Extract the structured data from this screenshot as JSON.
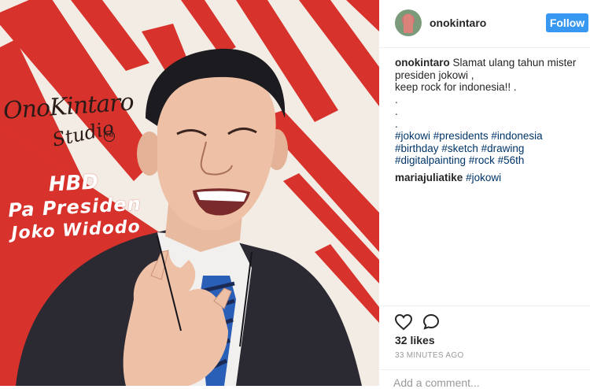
{
  "post_image": {
    "logo_line1": "OnoKintaro",
    "logo_line2": "Studio",
    "logo_tm": "TM",
    "greeting_line1": "HBD",
    "greeting_line2": "Pa Presiden",
    "greeting_line3": "Joko Widodo"
  },
  "header": {
    "username": "onokintaro",
    "follow_label": "Follow"
  },
  "caption": {
    "author": "onokintaro",
    "text_line1": "Slamat ulang tahun mister presiden jokowi ,",
    "text_line2": "keep rock for indonesia!! .",
    "dot1": ".",
    "dot2": ".",
    "dot3": ".",
    "hashtags": [
      "#jokowi",
      "#presidents",
      "#indonesia",
      "#birthday",
      "#sketch",
      "#drawing",
      "#digitalpainting",
      "#rock",
      "#56th"
    ]
  },
  "comments": [
    {
      "author": "mariajuliatike",
      "text": "#jokowi"
    }
  ],
  "actions": {
    "likes": "32 likes",
    "timestamp": "33 MINUTES AGO"
  },
  "add_comment": {
    "placeholder": "Add a comment..."
  },
  "colors": {
    "follow_blue": "#3897f0",
    "hashtag": "#003569",
    "stripe_red": "#d8322c",
    "poster_bg": "#f3ece4"
  }
}
